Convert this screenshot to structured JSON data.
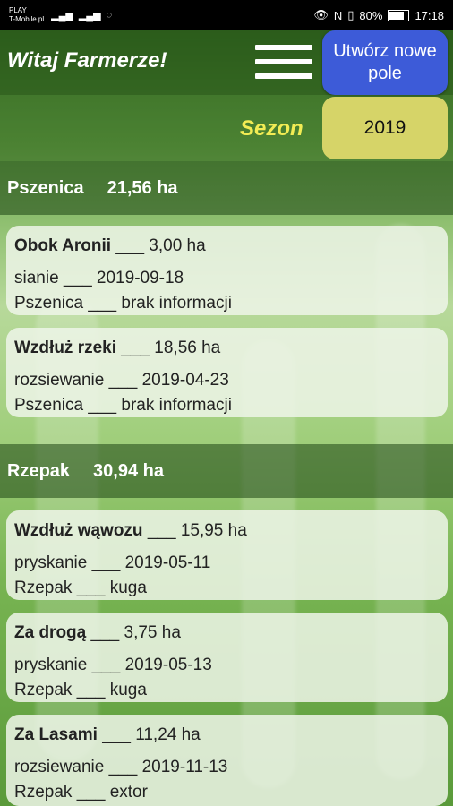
{
  "status_bar": {
    "carrier1": "PLAY",
    "carrier2": "T-Mobile.pl",
    "battery_pct": "80%",
    "time": "17:18"
  },
  "header": {
    "greeting": "Witaj Farmerze!",
    "new_field_button": "Utwórz nowe pole"
  },
  "season": {
    "label": "Sezon",
    "value": "2019"
  },
  "crops": [
    {
      "name": "Pszenica",
      "area": "21,56 ha",
      "fields": [
        {
          "name": "Obok Aronii",
          "area": "3,00 ha",
          "activity": "sianie",
          "date": "2019-09-18",
          "crop": "Pszenica",
          "note": "brak informacji"
        },
        {
          "name": "Wzdłuż rzeki",
          "area": "18,56 ha",
          "activity": "rozsiewanie",
          "date": "2019-04-23",
          "crop": "Pszenica",
          "note": "brak informacji"
        }
      ]
    },
    {
      "name": "Rzepak",
      "area": "30,94 ha",
      "fields": [
        {
          "name": "Wzdłuż wąwozu",
          "area": "15,95 ha",
          "activity": "pryskanie",
          "date": "2019-05-11",
          "crop": "Rzepak",
          "note": "kuga"
        },
        {
          "name": "Za drogą",
          "area": "3,75 ha",
          "activity": "pryskanie",
          "date": "2019-05-13",
          "crop": "Rzepak",
          "note": "kuga"
        },
        {
          "name": "Za Lasami",
          "area": "11,24 ha",
          "activity": "rozsiewanie",
          "date": "2019-11-13",
          "crop": "Rzepak",
          "note": "extor"
        }
      ]
    }
  ],
  "separator": "___",
  "colors": {
    "new_field_button": "#3d5bd8",
    "season_button": "#d6d468",
    "season_label": "#f2ec54"
  }
}
